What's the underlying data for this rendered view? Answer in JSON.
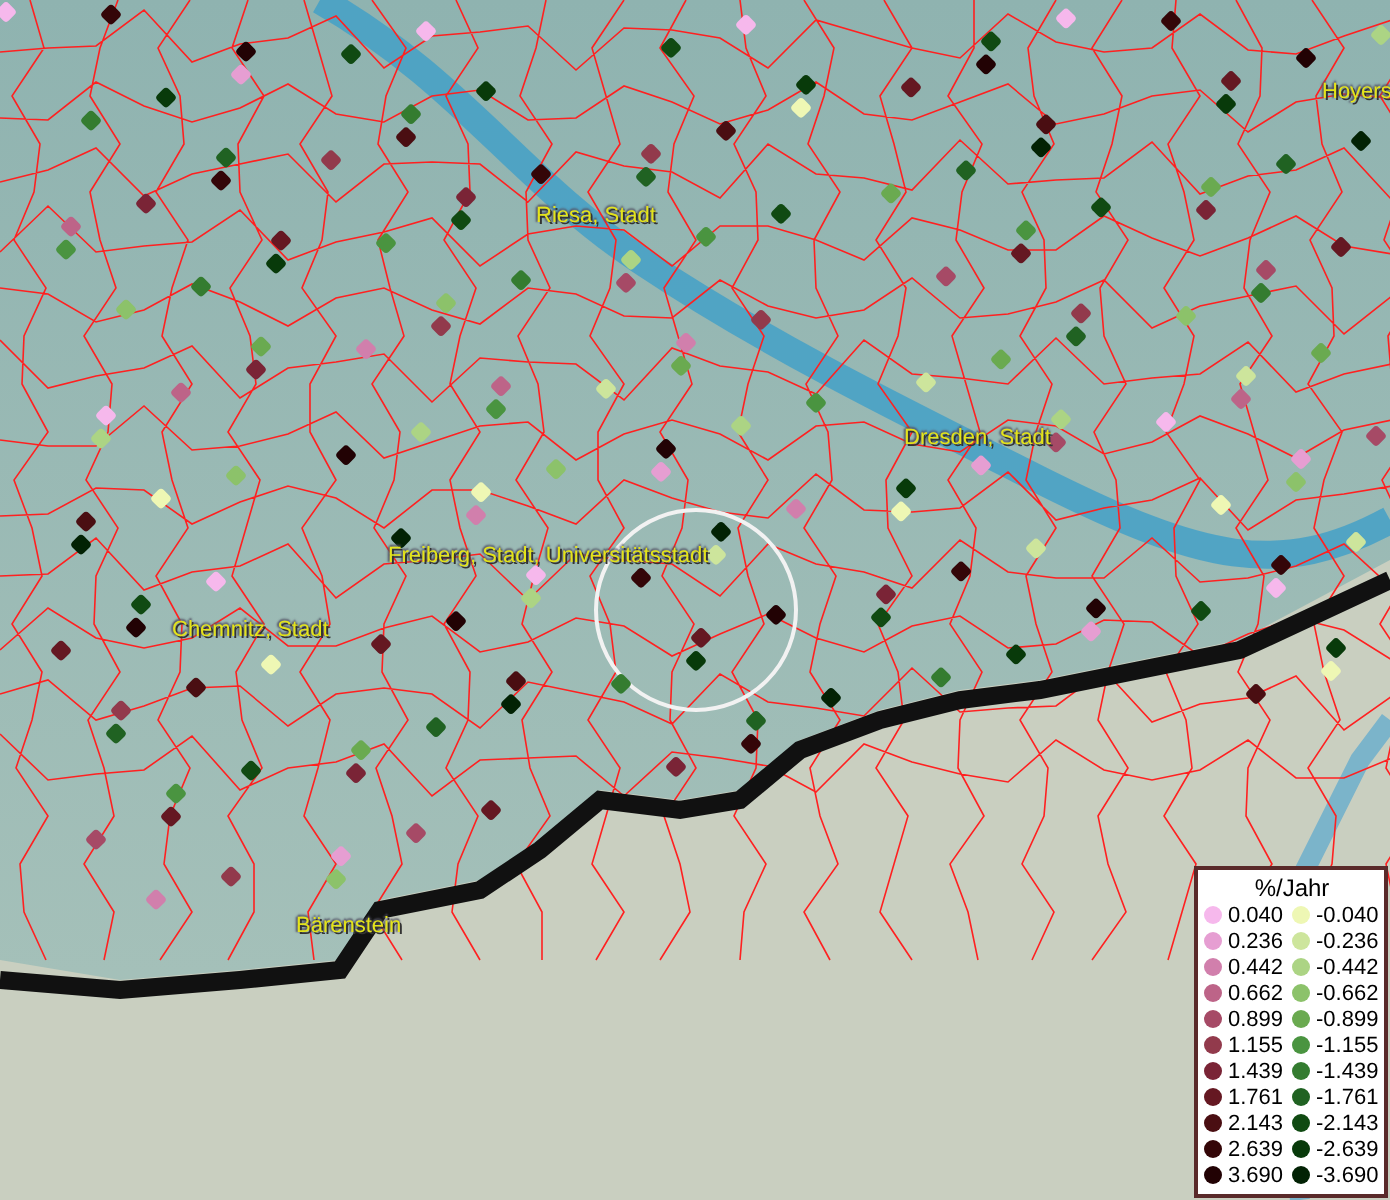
{
  "map": {
    "places": [
      {
        "name": "Riesa, Stadt"
      },
      {
        "name": "Dresden, Stadt"
      },
      {
        "name": "Freiberg, Stadt, Universitätsstadt"
      },
      {
        "name": "Chemnitz, Stadt"
      },
      {
        "name": "Bärenstein"
      },
      {
        "name": "Hoyers"
      }
    ]
  },
  "legend": {
    "title": "%/Jahr",
    "positive": [
      {
        "value": "0.040",
        "color": "#f6b8ec"
      },
      {
        "value": "0.236",
        "color": "#e69ed2"
      },
      {
        "value": "0.442",
        "color": "#d17fac"
      },
      {
        "value": "0.662",
        "color": "#bd6488"
      },
      {
        "value": "0.899",
        "color": "#a64a66"
      },
      {
        "value": "1.155",
        "color": "#923a4c"
      },
      {
        "value": "1.439",
        "color": "#7a2436"
      },
      {
        "value": "1.761",
        "color": "#651822"
      },
      {
        "value": "2.143",
        "color": "#4a0e12"
      },
      {
        "value": "2.639",
        "color": "#340608"
      },
      {
        "value": "3.690",
        "color": "#220204"
      }
    ],
    "negative": [
      {
        "value": "-0.040",
        "color": "#eef7b4"
      },
      {
        "value": "-0.236",
        "color": "#cde59c"
      },
      {
        "value": "-0.442",
        "color": "#acd484"
      },
      {
        "value": "-0.662",
        "color": "#8cc26a"
      },
      {
        "value": "-0.899",
        "color": "#6aaa50"
      },
      {
        "value": "-1.155",
        "color": "#4a9440"
      },
      {
        "value": "-1.439",
        "color": "#347c30"
      },
      {
        "value": "-1.761",
        "color": "#206222"
      },
      {
        "value": "-2.143",
        "color": "#104a12"
      },
      {
        "value": "-2.639",
        "color": "#083a0a"
      },
      {
        "value": "-3.690",
        "color": "#022204"
      }
    ]
  }
}
